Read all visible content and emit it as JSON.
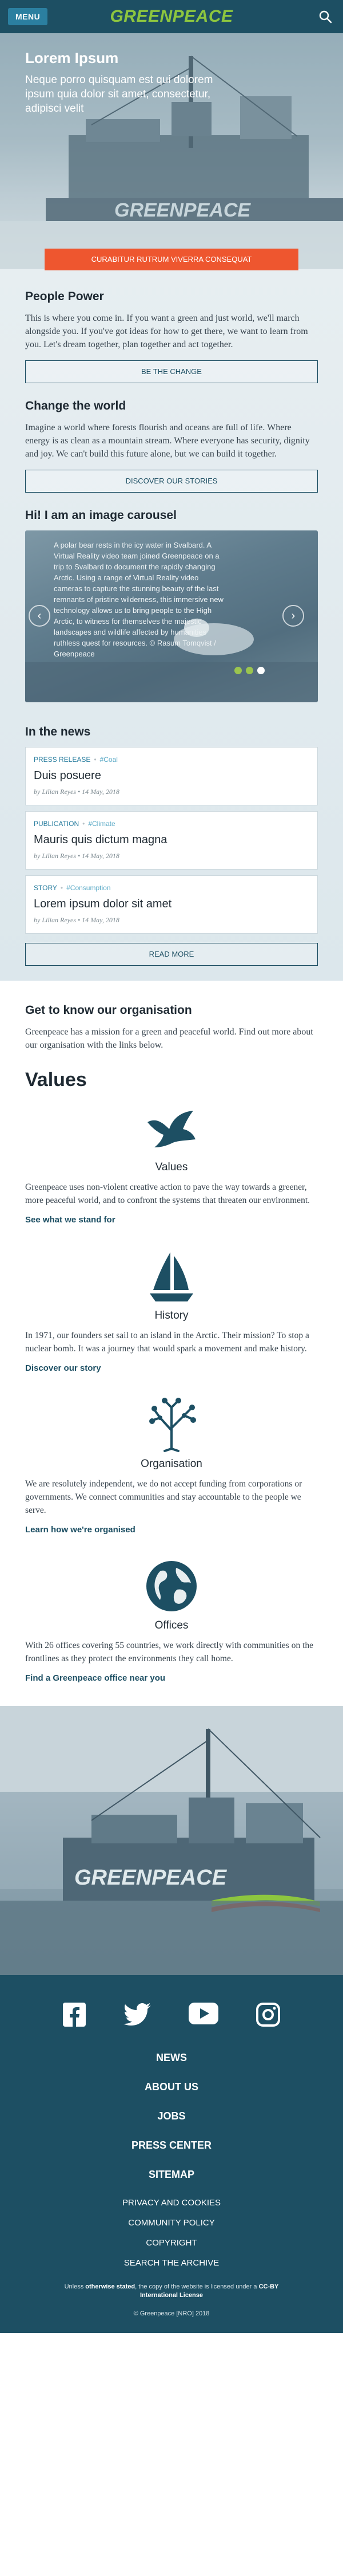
{
  "header": {
    "menu_label": "MENU",
    "logo_text": "GREENPEACE",
    "search_icon": "search-icon"
  },
  "hero": {
    "title": "Lorem Ipsum",
    "subtitle": "Neque porro quisquam est qui dolorem ipsum quia dolor sit amet, consectetur, adipisci velit",
    "cta_label": "CURABITUR RUTRUM VIVERRA CONSEQUAT",
    "ship_text": "GREENPEACE"
  },
  "people_power": {
    "title": "People Power",
    "body": "This is where you come in. If you want a green and just world, we'll march alongside you. If you've got ideas for how to get there, we want to learn from you. Let's dream together, plan together and act together.",
    "button": "BE THE CHANGE"
  },
  "change_world": {
    "title": "Change the world",
    "body": "Imagine a world where forests flourish and oceans are full of life. Where energy is as clean as a mountain stream. Where everyone has security, dignity and joy. We can't build this future alone, but we can build it together.",
    "button": "DISCOVER OUR STORIES"
  },
  "carousel": {
    "title": "Hi! I am an image carousel",
    "caption": "A polar bear rests in the icy water in Svalbard. A Virtual Reality video team joined Greenpeace on a trip to Svalbard to document the rapidly changing Arctic. Using a range of Virtual Reality video cameras to capture the stunning beauty of the last remnants of pristine wilderness, this immersive new technology allows us to bring people to the High Arctic, to witness for themselves the majestic landscapes and wildlife affected by humanities ruthless quest for resources. © Rasum Tomqvist / Greenpeace",
    "slide_count": 3,
    "active_slide": 3
  },
  "news": {
    "title": "In the news",
    "items": [
      {
        "category": "PRESS RELEASE",
        "tag": "#Coal",
        "title": "Duis posuere",
        "byline": "by Lilian Reyes • 14 May, 2018"
      },
      {
        "category": "PUBLICATION",
        "tag": "#Climate",
        "title": "Mauris quis dictum magna",
        "byline": "by Lilian Reyes • 14 May, 2018"
      },
      {
        "category": "STORY",
        "tag": "#Consumption",
        "title": "Lorem ipsum dolor sit amet",
        "byline": "by Lilian Reyes • 14 May, 2018"
      }
    ],
    "read_more": "READ MORE"
  },
  "organisation": {
    "title": "Get to know our organisation",
    "body": "Greenpeace has a mission for a green and peaceful world. Find out more about our organisation with the links below.",
    "values_title": "Values",
    "items": [
      {
        "icon": "dove-icon",
        "label": "Values",
        "body": "Greenpeace uses non-violent creative action to pave the way towards a greener, more peaceful world, and to confront the systems that threaten our environment.",
        "link": "See what we stand for"
      },
      {
        "icon": "sailboat-icon",
        "label": "History",
        "body": "In 1971, our founders set sail to an island in the Arctic. Their mission? To stop a nuclear bomb. It was a journey that would spark a movement and make history.",
        "link": "Discover our story"
      },
      {
        "icon": "tree-icon",
        "label": "Organisation",
        "body": "We are resolutely independent, we do not accept funding from corporations or governments. We connect communities and stay accountable to the people we serve.",
        "link": "Learn how we're organised"
      },
      {
        "icon": "globe-icon",
        "label": "Offices",
        "body": "With 26 offices covering 55 countries, we work directly with communities on the frontlines as they protect the environments they call home.",
        "link": "Find a Greenpeace office near you"
      }
    ]
  },
  "banner": {
    "ship_text": "GREENPEACE"
  },
  "footer": {
    "social": [
      "facebook-icon",
      "twitter-icon",
      "youtube-icon",
      "instagram-icon"
    ],
    "nav": [
      "NEWS",
      "ABOUT US",
      "JOBS",
      "PRESS CENTER",
      "SITEMAP"
    ],
    "sub_nav": [
      "PRIVACY AND COOKIES",
      "COMMUNITY POLICY",
      "COPYRIGHT",
      "SEARCH THE ARCHIVE"
    ],
    "license_prefix": "Unless ",
    "license_bold1": "otherwise stated",
    "license_mid": ", the copy of the website is licensed under a ",
    "license_bold2": "CC-BY International License",
    "copyright": "© Greenpeace [NRO] 2018"
  },
  "colors": {
    "brand": "#1d4f63",
    "accent": "#ee562f",
    "logo": "#8dc63f"
  }
}
